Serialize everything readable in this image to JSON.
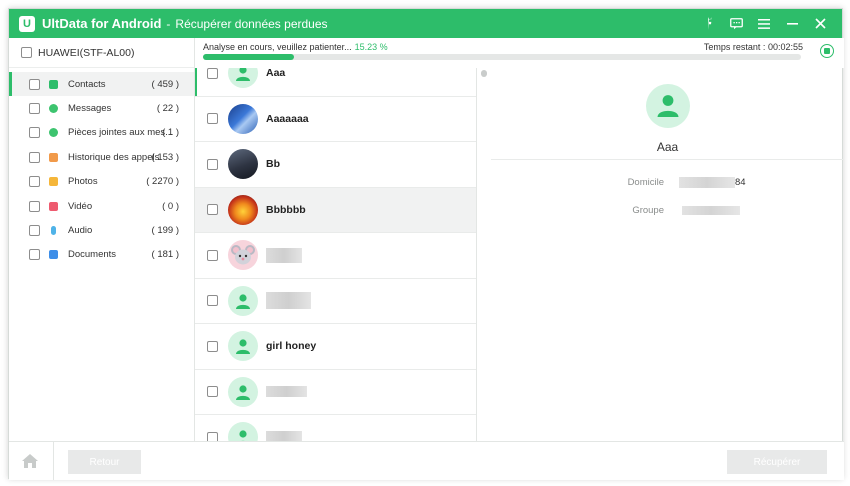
{
  "app": {
    "logo_letter": "U",
    "name": "UltData for Android",
    "separator": "-",
    "title": "Récupérer données perdues",
    "accent_color": "#2dbd6a",
    "title_icons": [
      "facebook-icon",
      "feedback-icon",
      "menu-icon",
      "minimize-icon",
      "close-icon"
    ]
  },
  "device": {
    "name": "HUAWEI(STF-AL00)"
  },
  "progress": {
    "status": "Analyse en cours, veuillez patienter...",
    "percent_text": "15.23 %",
    "percent": 15.23,
    "remaining_label": "Temps restant :",
    "remaining_value": "00:02:55"
  },
  "categories": [
    {
      "label": "Contacts",
      "count": "( 459 )",
      "icon": "contacts-icon",
      "color": "#2dbd6a"
    },
    {
      "label": "Messages",
      "count": "( 22 )",
      "icon": "messages-icon",
      "color": "#3dc46f"
    },
    {
      "label": "Pièces jointes aux mes...",
      "count": "( 1 )",
      "icon": "attachments-icon",
      "color": "#3dc46f"
    },
    {
      "label": "Historique des appels",
      "count": "( 153 )",
      "icon": "call-history-icon",
      "color": "#f19a4a"
    },
    {
      "label": "Photos",
      "count": "( 2270 )",
      "icon": "photos-icon",
      "color": "#f5b63a"
    },
    {
      "label": "Vidéo",
      "count": "( 0 )",
      "icon": "video-icon",
      "color": "#ee5a6f"
    },
    {
      "label": "Audio",
      "count": "( 199 )",
      "icon": "audio-icon",
      "color": "#4fb3e8"
    },
    {
      "label": "Documents",
      "count": "( 181 )",
      "icon": "documents-icon",
      "color": "#3d8ee8"
    }
  ],
  "contacts": [
    {
      "name": "Aaa"
    },
    {
      "name": "Aaaaaaa"
    },
    {
      "name": "Bb"
    },
    {
      "name": "Bbbbbb"
    },
    {
      "name": ""
    },
    {
      "name": ""
    },
    {
      "name": "girl honey"
    },
    {
      "name": ""
    },
    {
      "name": ""
    }
  ],
  "detail": {
    "name": "Aaa",
    "fields": [
      {
        "label": "Domicile",
        "value_suffix": "84"
      },
      {
        "label": "Groupe",
        "value_suffix": ""
      }
    ]
  },
  "bottom": {
    "back_label": "Retour",
    "recover_label": "Récupérer"
  }
}
